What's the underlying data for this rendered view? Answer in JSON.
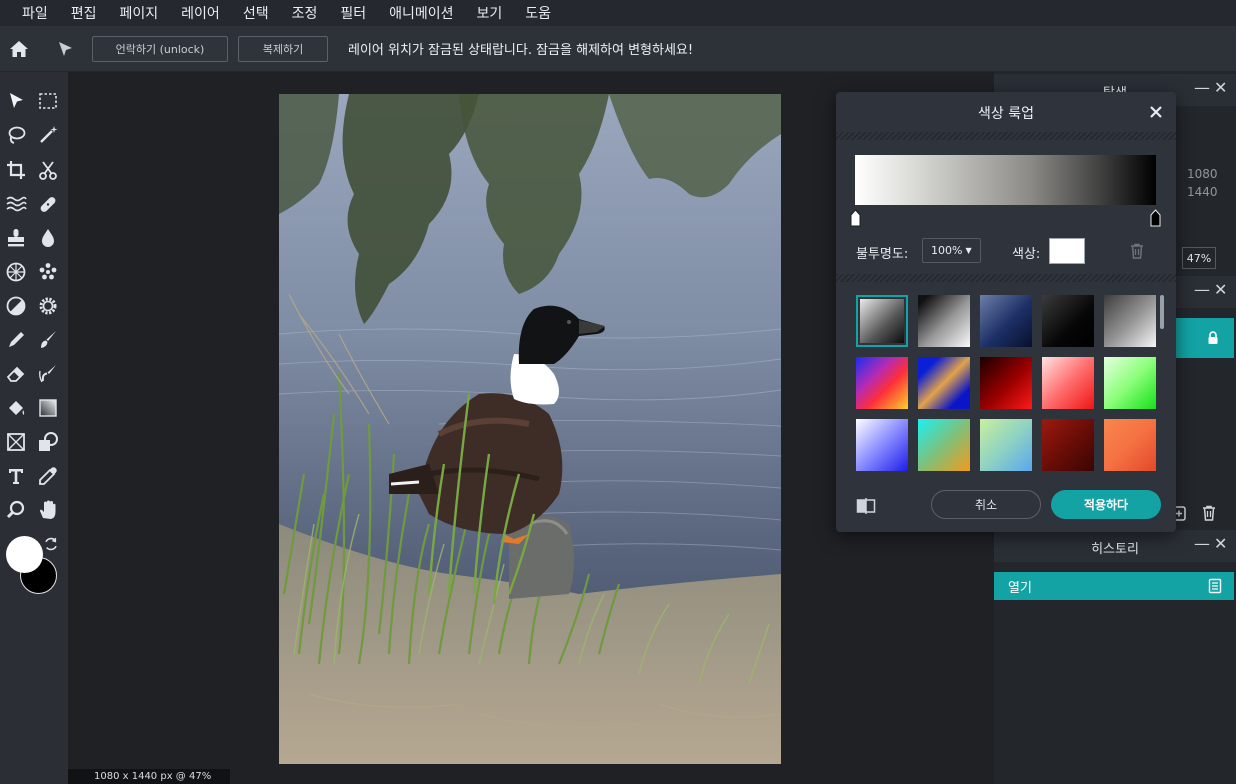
{
  "menu": [
    "파일",
    "편집",
    "페이지",
    "레이어",
    "선택",
    "조정",
    "필터",
    "애니메이션",
    "보기",
    "도움"
  ],
  "toolbar": {
    "unlock_label": "언락하기 (unlock)",
    "duplicate_label": "복제하기",
    "lock_message": "레이어 위치가 잠금된 상태랍니다. 잠금을 해제하여 변형하세요!"
  },
  "status": {
    "text": "1080 x 1440 px @ 47%"
  },
  "navigator": {
    "title": "탐색",
    "width": "1080",
    "height": "1440",
    "zoom": "47%"
  },
  "history": {
    "title": "히스토리",
    "items": [
      "열기"
    ]
  },
  "modal": {
    "title": "색상 룩업",
    "opacity_label": "불투명도:",
    "opacity_value": "100%",
    "color_label": "색상:",
    "cancel_label": "취소",
    "apply_label": "적용하다",
    "swatch_count": 15
  },
  "colors": {
    "accent": "#13a3a5",
    "menubar": "#25292f",
    "panel": "#2f343c"
  }
}
